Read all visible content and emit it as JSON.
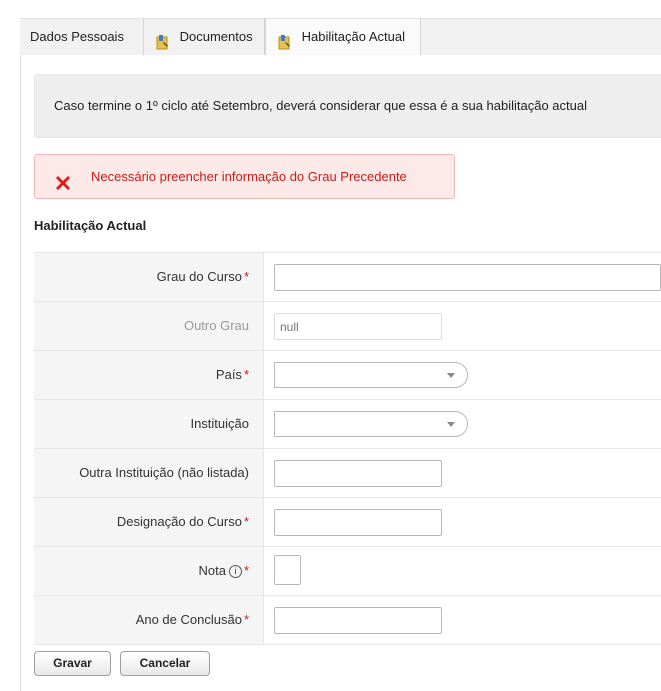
{
  "tabs": [
    {
      "label": "Dados Pessoais",
      "icon": "none",
      "active": false
    },
    {
      "label": "Documentos",
      "icon": "document-pencil-icon",
      "active": false
    },
    {
      "label": "Habilitação Actual",
      "icon": "document-pencil-icon",
      "active": true
    }
  ],
  "info_message": "Caso termine o 1º ciclo até Setembro, deverá considerar que essa é a sua habilitação actual",
  "error_message": "Necessário preencher informação do Grau Precedente",
  "section_title": "Habilitação Actual",
  "form": {
    "grau_label": "Grau do Curso",
    "grau_value": "",
    "outro_grau_label": "Outro Grau",
    "outro_grau_value": "null",
    "pais_label": "País",
    "pais_value": "",
    "instituicao_label": "Instituição",
    "instituicao_value": "",
    "outra_instituicao_label": "Outra Instituição (não listada)",
    "outra_instituicao_value": "",
    "designacao_label": "Designação do Curso",
    "designacao_value": "",
    "nota_label": "Nota",
    "nota_value": "",
    "ano_label": "Ano de Conclusão",
    "ano_value": "",
    "required_mark": "*",
    "info_icon_glyph": "i"
  },
  "buttons": {
    "save": "Gravar",
    "cancel": "Cancelar"
  },
  "colors": {
    "error_text": "#c61e18",
    "error_bg": "#fde9e8",
    "info_bg": "#eeeeee",
    "label_bg": "#f5f5f5"
  }
}
